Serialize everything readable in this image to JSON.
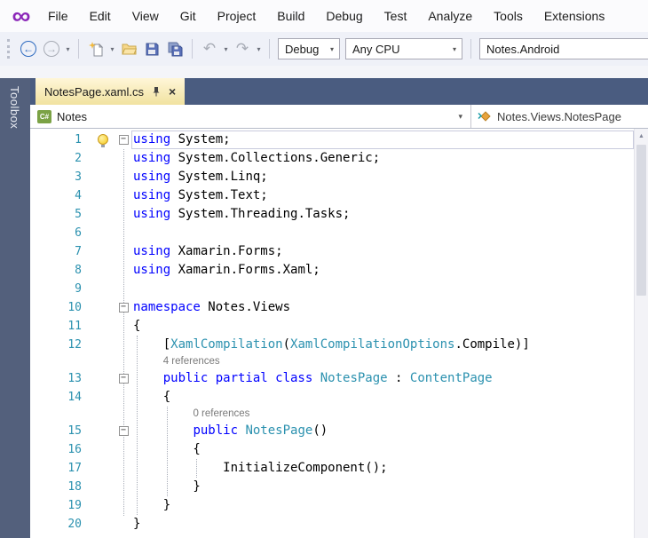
{
  "colors": {
    "accent_purple": "#8B26B8",
    "tab_well": "#4A5C80",
    "active_tab": "#F1E2A0",
    "keyword": "#0000FF",
    "type": "#2B91AF",
    "line_number": "#2B91AF"
  },
  "menu_bar": {
    "items": [
      "File",
      "Edit",
      "View",
      "Git",
      "Project",
      "Build",
      "Debug",
      "Test",
      "Analyze",
      "Tools",
      "Extensions"
    ]
  },
  "toolbar": {
    "solution_configuration": "Debug",
    "solution_platform": "Any CPU",
    "startup_project": "Notes.Android"
  },
  "icons": {
    "caret": "▾",
    "back": "←",
    "forward": "→",
    "undo": "↶",
    "redo": "↷",
    "fold_collapse": "−",
    "scroll_up": "▲",
    "close": "×",
    "infinity_logo": "∞"
  },
  "side_tab": {
    "label": "Toolbox"
  },
  "document_tab": {
    "label": "NotesPage.xaml.cs"
  },
  "nav_bar": {
    "project": "Notes",
    "project_icon_text": "C#",
    "member": "Notes.Views.NotesPage"
  },
  "editor": {
    "lines": [
      {
        "num": 1,
        "fold": true,
        "bulb": true,
        "current": true,
        "tokens": [
          [
            "kw",
            "using"
          ],
          [
            "pl",
            " System;"
          ]
        ]
      },
      {
        "num": 2,
        "tokens": [
          [
            "kw",
            "using"
          ],
          [
            "pl",
            " System.Collections.Generic;"
          ]
        ]
      },
      {
        "num": 3,
        "tokens": [
          [
            "kw",
            "using"
          ],
          [
            "pl",
            " System.Linq;"
          ]
        ]
      },
      {
        "num": 4,
        "tokens": [
          [
            "kw",
            "using"
          ],
          [
            "pl",
            " System.Text;"
          ]
        ]
      },
      {
        "num": 5,
        "tokens": [
          [
            "kw",
            "using"
          ],
          [
            "pl",
            " System.Threading.Tasks;"
          ]
        ]
      },
      {
        "num": 6,
        "tokens": []
      },
      {
        "num": 7,
        "tokens": [
          [
            "kw",
            "using"
          ],
          [
            "pl",
            " Xamarin.Forms;"
          ]
        ]
      },
      {
        "num": 8,
        "tokens": [
          [
            "kw",
            "using"
          ],
          [
            "pl",
            " Xamarin.Forms.Xaml;"
          ]
        ]
      },
      {
        "num": 9,
        "tokens": []
      },
      {
        "num": 10,
        "fold": true,
        "tokens": [
          [
            "kw",
            "namespace"
          ],
          [
            "pl",
            " Notes.Views"
          ]
        ]
      },
      {
        "num": 11,
        "tokens": [
          [
            "pl",
            "{"
          ]
        ]
      },
      {
        "num": 12,
        "tokens": [
          [
            "pl",
            "    ["
          ],
          [
            "ty",
            "XamlCompilation"
          ],
          [
            "pl",
            "("
          ],
          [
            "ty",
            "XamlCompilationOptions"
          ],
          [
            "pl",
            ".Compile)]"
          ]
        ]
      },
      {
        "lens": "4 references",
        "indent": 4
      },
      {
        "num": 13,
        "fold": true,
        "tokens": [
          [
            "pl",
            "    "
          ],
          [
            "kw",
            "public partial class"
          ],
          [
            "pl",
            " "
          ],
          [
            "ty",
            "NotesPage"
          ],
          [
            "pl",
            " : "
          ],
          [
            "ty",
            "ContentPage"
          ]
        ]
      },
      {
        "num": 14,
        "tokens": [
          [
            "pl",
            "    {"
          ]
        ]
      },
      {
        "lens": "0 references",
        "indent": 8
      },
      {
        "num": 15,
        "fold": true,
        "tokens": [
          [
            "pl",
            "        "
          ],
          [
            "kw",
            "public"
          ],
          [
            "pl",
            " "
          ],
          [
            "ty",
            "NotesPage"
          ],
          [
            "pl",
            "()"
          ]
        ]
      },
      {
        "num": 16,
        "tokens": [
          [
            "pl",
            "        {"
          ]
        ]
      },
      {
        "num": 17,
        "tokens": [
          [
            "pl",
            "            InitializeComponent();"
          ]
        ]
      },
      {
        "num": 18,
        "tokens": [
          [
            "pl",
            "        }"
          ]
        ]
      },
      {
        "num": 19,
        "tokens": [
          [
            "pl",
            "    }"
          ]
        ]
      },
      {
        "num": 20,
        "tokens": [
          [
            "pl",
            "}"
          ]
        ]
      }
    ]
  }
}
